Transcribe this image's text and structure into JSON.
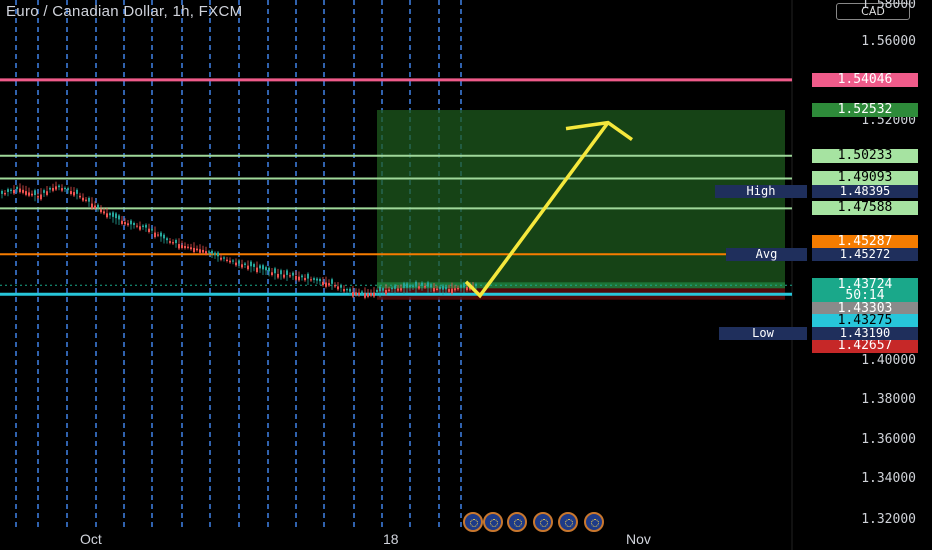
{
  "chart": {
    "title": "Euro / Canadian Dollar, 1h, FXCM",
    "currency": "CAD",
    "axis_ticks": [
      "1.58000",
      "1.56000",
      "1.52000",
      "1.40000",
      "1.38000",
      "1.36000",
      "1.34000",
      "1.32000"
    ],
    "date_labels": [
      "Oct",
      "18",
      "Nov"
    ],
    "stats": {
      "high_label": "High",
      "high_value": "1.48395",
      "avg_label": "Avg",
      "avg_value": "1.45272",
      "low_label": "Low",
      "low_value": "1.43190"
    },
    "price_tags": {
      "p1": "1.54046",
      "p2": "1.52532",
      "p3": "1.50233",
      "p4": "1.49093",
      "p5": "1.47588",
      "p6": "1.45287",
      "p7": "1.43724",
      "countdown": "50:14",
      "p8": "1.43303",
      "p9": "1.43275",
      "p10": "1.42657"
    },
    "colors": {
      "pink_line": "#ef5b8a",
      "green_line": "#9fd89a",
      "orange_line": "#f57c00",
      "cyan_line": "#27c6da",
      "target_zone": "#1e5a1e",
      "stop_zone": "#5a0a0a",
      "arrow": "#f5e83c",
      "candle_up": "#26a69a",
      "candle_down": "#ef5350"
    }
  },
  "chart_data": {
    "type": "line",
    "title": "Euro / Canadian Dollar, 1h, FXCM",
    "ylim": [
      1.31,
      1.58
    ],
    "yticks": [
      1.58,
      1.56,
      1.52,
      1.4,
      1.38,
      1.36,
      1.34,
      1.32
    ],
    "xtick_labels": [
      "Oct",
      "18",
      "Nov"
    ],
    "horizontal_levels": [
      1.54046,
      1.50233,
      1.49093,
      1.47588,
      1.45287,
      1.43275
    ],
    "series": [
      {
        "values": [
          1.483,
          1.486,
          1.482,
          1.487,
          1.484,
          1.478,
          1.472,
          1.468,
          1.466,
          1.46,
          1.457,
          1.455,
          1.451,
          1.448,
          1.446,
          1.443,
          1.442,
          1.44,
          1.438,
          1.434,
          1.433,
          1.435,
          1.436,
          1.437,
          1.435,
          1.436,
          1.437
        ]
      }
    ],
    "projection": {
      "from": 1.432,
      "to": 1.519
    },
    "target_zone": [
      1.43724,
      1.52532
    ],
    "stop_zone": [
      1.43,
      1.43724
    ]
  }
}
